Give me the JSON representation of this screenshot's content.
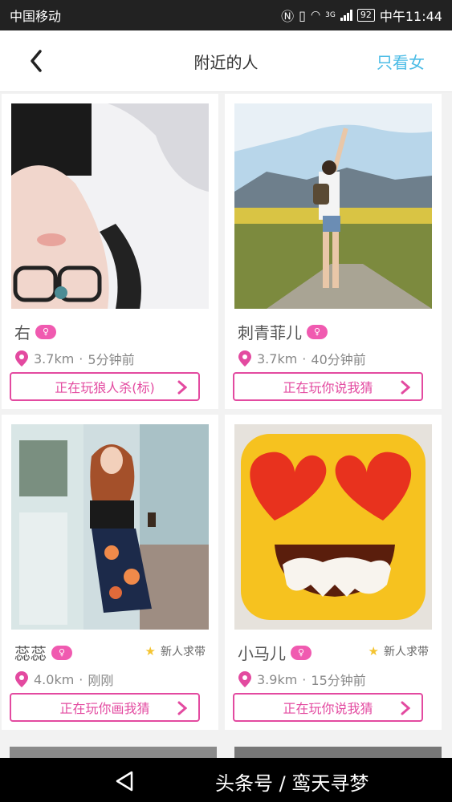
{
  "status_bar": {
    "carrier": "中国移动",
    "icons": [
      "nfc-icon",
      "vibrate-icon",
      "wifi-icon",
      "signal-icon"
    ],
    "network": "3G",
    "battery": "92",
    "time": "中午11:44"
  },
  "header": {
    "title": "附近的人",
    "filter_label": "只看女",
    "accent_color": "#4cbce6"
  },
  "cards": [
    {
      "nickname": "右",
      "gender": "female",
      "distance": "3.7km",
      "last_active": "5分钟前",
      "activity_label": "正在玩狼人杀(标)",
      "badge": ""
    },
    {
      "nickname": "刺青菲儿",
      "gender": "female",
      "distance": "3.7km",
      "last_active": "40分钟前",
      "activity_label": "正在玩你说我猜",
      "badge": ""
    },
    {
      "nickname": "蕊蕊",
      "gender": "female",
      "distance": "4.0km",
      "last_active": "刚刚",
      "activity_label": "正在玩你画我猜",
      "badge": "新人求带"
    },
    {
      "nickname": "小马儿",
      "gender": "female",
      "distance": "3.9km",
      "last_active": "15分钟前",
      "activity_label": "正在玩你说我猜",
      "badge": "新人求带"
    }
  ],
  "separator": " · ",
  "nav_bar": {
    "watermark": "头条号 / 鸾天寻梦"
  },
  "colors": {
    "pink": "#e34aa0",
    "gender_badge": "#f05ab0",
    "star": "#f4c431"
  }
}
